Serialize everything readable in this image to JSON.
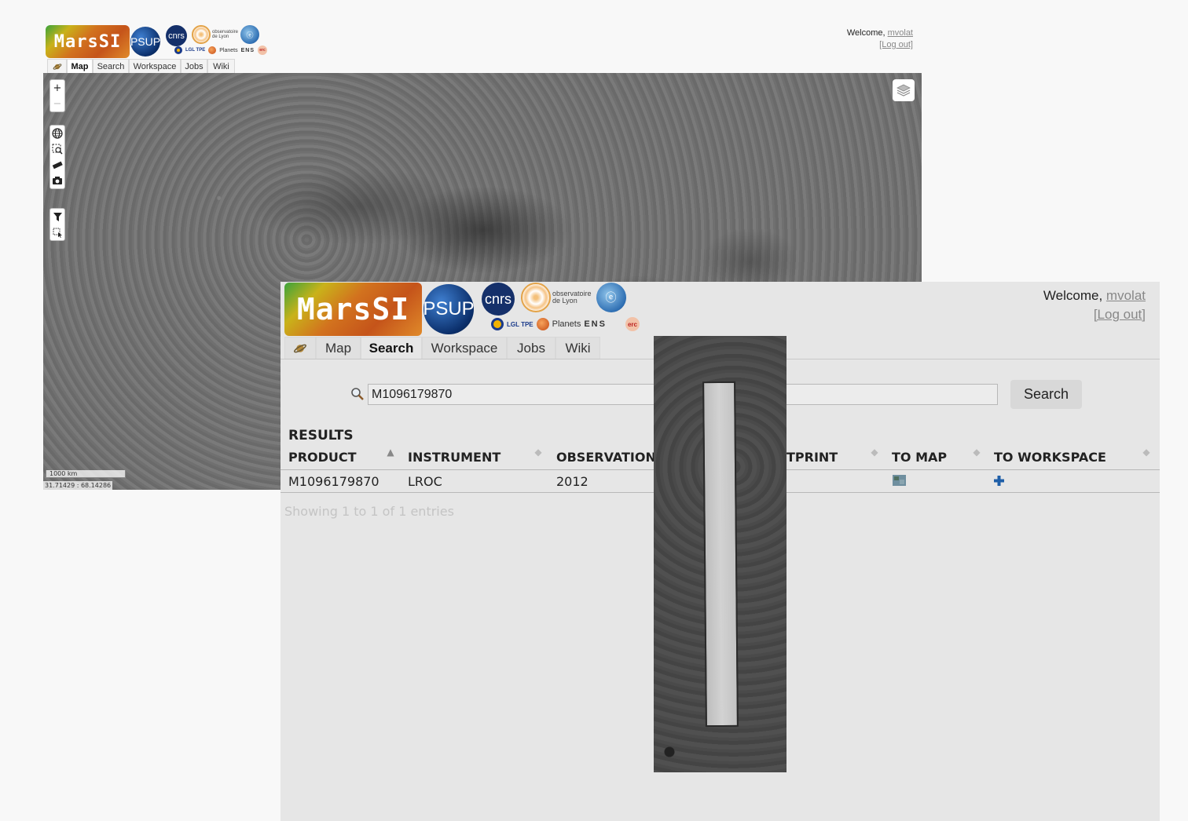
{
  "back_window": {
    "logos": {
      "marssi": "MarsSI",
      "psup": "PSUP",
      "cnrs": "cnrs",
      "obs_line1": "observatoire",
      "obs_line2": "de Lyon",
      "lgl": "LGL TPE",
      "planets": "Planets",
      "ens": "ENS",
      "erc": "erc"
    },
    "welcome_prefix": "Welcome,",
    "username": "mvolat",
    "logout": "[Log out]",
    "tabs": [
      "Map",
      "Search",
      "Workspace",
      "Jobs",
      "Wiki"
    ],
    "active_tab": "Map",
    "map": {
      "zoom_in": "+",
      "zoom_out": "−",
      "scale_label": "1000 km",
      "coordinates": "31.71429 : 68.14286"
    }
  },
  "front_window": {
    "logos": {
      "marssi": "MarsSI",
      "psup": "PSUP",
      "cnrs": "cnrs",
      "obs_line1": "observatoire",
      "obs_line2": "de Lyon",
      "lgl": "LGL TPE",
      "planets": "Planets",
      "ens": "ENS",
      "erc": "erc"
    },
    "welcome_prefix": "Welcome,",
    "username": "mvolat",
    "logout": "[Log out]",
    "tabs": [
      "Map",
      "Search",
      "Workspace",
      "Jobs",
      "Wiki"
    ],
    "active_tab": "Search",
    "search": {
      "value": "M1096179870",
      "button": "Search"
    },
    "results": {
      "title": "RESULTS",
      "columns": [
        "PRODUCT",
        "INSTRUMENT",
        "OBSERVATION TI",
        "TPRINT",
        "TO MAP",
        "TO WORKSPACE"
      ],
      "rows": [
        {
          "product": "M1096179870",
          "instrument": "LROC",
          "observation": "2012"
        }
      ],
      "info": "Showing 1 to 1 of 1 entries"
    }
  },
  "colors": {
    "link_gray": "#888888",
    "add_blue": "#1f5fa8"
  },
  "icons": [
    "planet-icon",
    "globe-icon",
    "zoom-box-icon",
    "ruler-icon",
    "camera-icon",
    "filter-icon",
    "select-box-icon",
    "layers-icon",
    "search-icon",
    "map-thumbnail-icon",
    "plus-icon"
  ]
}
